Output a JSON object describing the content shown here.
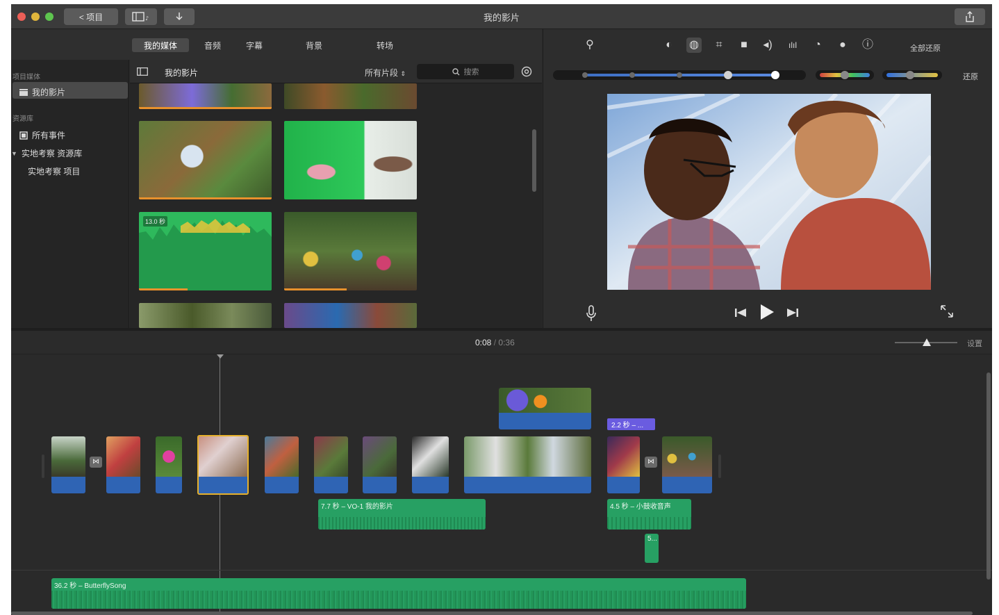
{
  "window": {
    "title": "我的影片",
    "back_button": "< 项目",
    "share_icon": "share-icon",
    "colors": {
      "window_bg": "#2b2b2b",
      "video_clip_audio": "#2f64b4",
      "audio_clip": "#27a063",
      "title_clip": "#6a5ce0",
      "selection": "#e6b12c"
    }
  },
  "toolbar": {
    "media_button_icon": "media-browser-icon",
    "import_button_icon": "import-arrow-icon"
  },
  "tabs": [
    "我的媒体",
    "音频",
    "字幕",
    "背景",
    "转场"
  ],
  "sidebar": {
    "section_project_media": "项目媒体",
    "project_item": "我的影片",
    "section_library": "资源库",
    "all_events": "所有事件",
    "library_name": "实地考察 资源库",
    "library_event": "实地考察 项目"
  },
  "browser": {
    "title": "我的影片",
    "filter": "所有片段",
    "search_placeholder": "搜索",
    "audio_clip_duration": "13.0 秒"
  },
  "viewer": {
    "auto_label": "全部还原",
    "reset_label": "还原",
    "tool_icons": [
      "magic-wand-icon",
      "color-balance-icon",
      "color-correction-icon",
      "crop-icon",
      "stabilization-icon",
      "volume-icon",
      "noise-reduction-icon",
      "speed-icon",
      "clip-filter-icon",
      "info-icon"
    ]
  },
  "timeline": {
    "current_time": "0:08",
    "separator": "/",
    "total_time": "0:36",
    "settings_label": "设置",
    "title_clip_label": "2.2 秒 – ...",
    "voiceover_label": "7.7 秒 – VO-1 我的影片",
    "sfx_label": "4.5 秒 – 小鼓收音声",
    "small_audio_label": "5...",
    "music_label": "36.2 秒 – ButterflySong"
  }
}
